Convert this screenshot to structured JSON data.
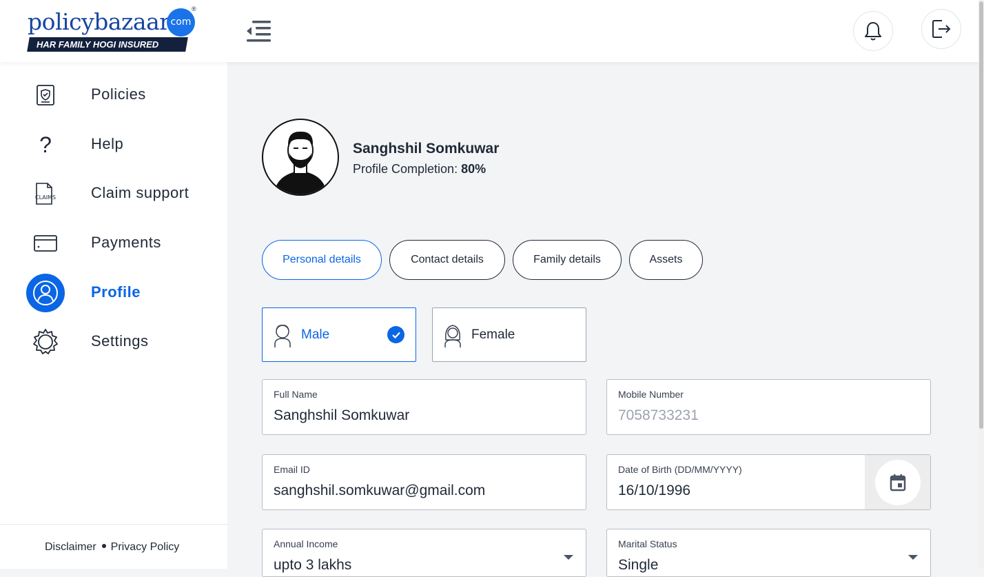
{
  "brand": {
    "name": "policybazaar",
    "domain_badge": "com",
    "registered": "®",
    "tagline": "HAR FAMILY HOGI INSURED"
  },
  "header": {
    "menu_icon": "menu-collapse-icon",
    "notification_icon": "bell-icon",
    "logout_icon": "logout-icon"
  },
  "sidebar": {
    "items": [
      {
        "label": "Policies",
        "icon": "policy-shield-icon",
        "active": false
      },
      {
        "label": "Help",
        "icon": "question-icon",
        "active": false
      },
      {
        "label": "Claim support",
        "icon": "claims-document-icon",
        "active": false
      },
      {
        "label": "Payments",
        "icon": "card-icon",
        "active": false
      },
      {
        "label": "Profile",
        "icon": "user-icon",
        "active": true
      },
      {
        "label": "Settings",
        "icon": "gear-icon",
        "active": false
      }
    ],
    "footer": {
      "disclaimer": "Disclaimer",
      "privacy": "Privacy Policy"
    }
  },
  "profile": {
    "name": "Sanghshil Somkuwar",
    "completion_label": "Profile Completion:",
    "completion_value": "80%"
  },
  "tabs": [
    {
      "label": "Personal details",
      "active": true
    },
    {
      "label": "Contact details",
      "active": false
    },
    {
      "label": "Family details",
      "active": false
    },
    {
      "label": "Assets",
      "active": false
    }
  ],
  "gender": {
    "options": [
      {
        "label": "Male",
        "selected": true
      },
      {
        "label": "Female",
        "selected": false
      }
    ]
  },
  "form": {
    "full_name": {
      "label": "Full Name",
      "value": "Sanghshil Somkuwar"
    },
    "mobile": {
      "label": "Mobile Number",
      "value": "7058733231"
    },
    "email": {
      "label": "Email ID",
      "value": "sanghshil.somkuwar@gmail.com"
    },
    "dob": {
      "label": "Date of Birth (DD/MM/YYYY)",
      "value": "16/10/1996"
    },
    "income": {
      "label": "Annual Income",
      "value": "upto 3 lakhs"
    },
    "marital": {
      "label": "Marital Status",
      "value": "Single"
    }
  },
  "colors": {
    "accent": "#0a66e4",
    "brand_blue": "#1746a2",
    "brand_navy": "#14213d",
    "text": "#1f2937",
    "muted": "#9ca3af",
    "page_bg": "#f3f4f6"
  }
}
